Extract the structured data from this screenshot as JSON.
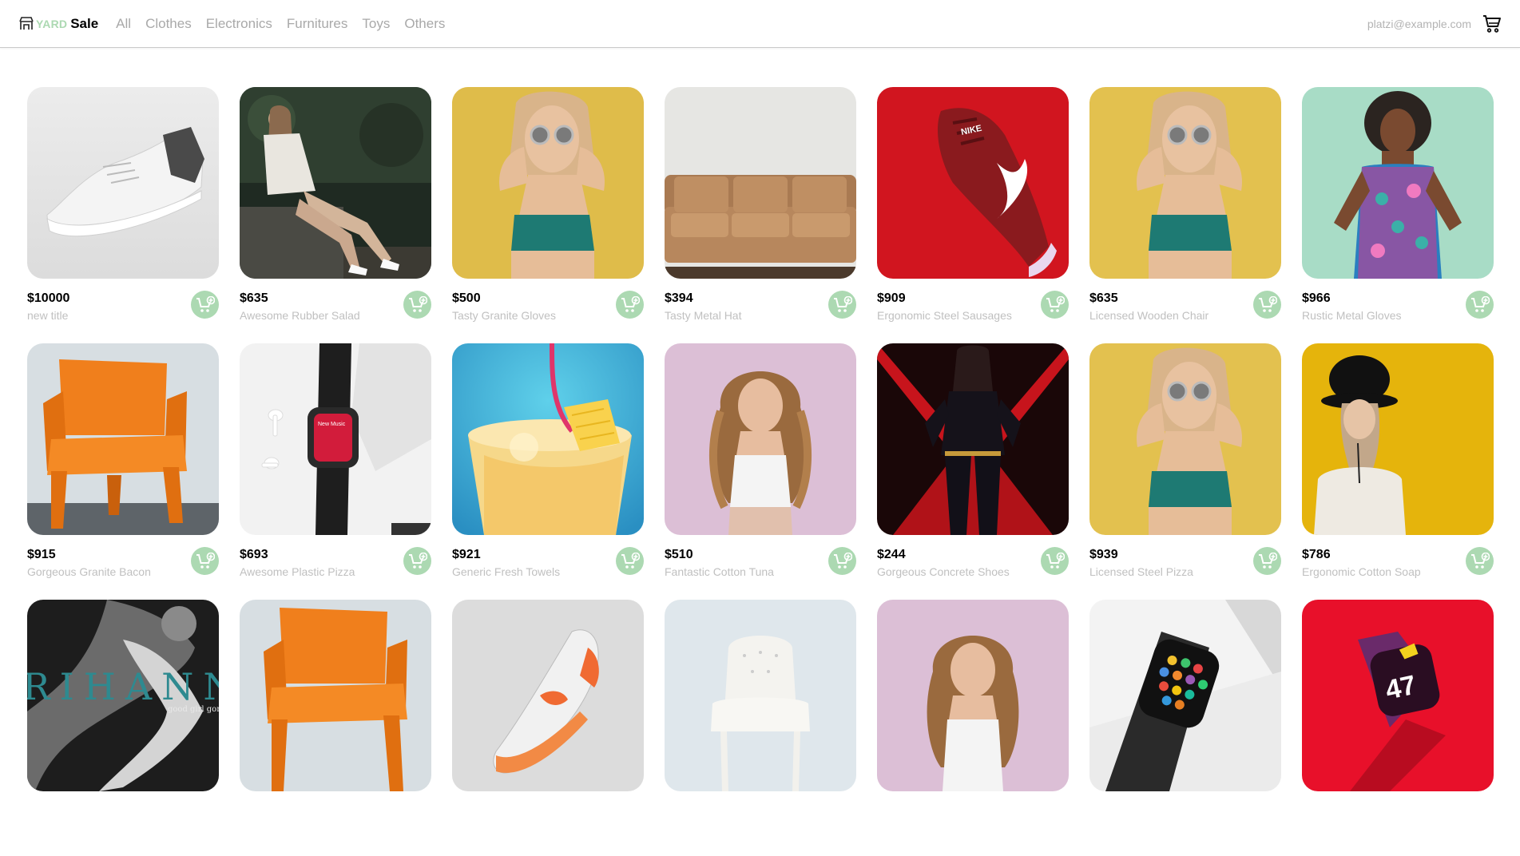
{
  "brand": {
    "yard": "YARD",
    "sale": "Sale",
    "icon": "shop-icon",
    "accent": "#acd9b2"
  },
  "nav": {
    "categories": [
      "All",
      "Clothes",
      "Electronics",
      "Furnitures",
      "Toys",
      "Others"
    ]
  },
  "account": {
    "email": "platzi@example.com",
    "cart_icon": "shopping-cart-icon"
  },
  "products": [
    {
      "price": "$10000",
      "name": "new title",
      "image": "white-sneaker"
    },
    {
      "price": "$635",
      "name": "Awesome Rubber Salad",
      "image": "woman-sitting-outdoors"
    },
    {
      "price": "$500",
      "name": "Tasty Granite Gloves",
      "image": "woman-sunglasses-yellow"
    },
    {
      "price": "$394",
      "name": "Tasty Metal Hat",
      "image": "leather-sofa"
    },
    {
      "price": "$909",
      "name": "Ergonomic Steel Sausages",
      "image": "red-running-shoe"
    },
    {
      "price": "$635",
      "name": "Licensed Wooden Chair",
      "image": "woman-sunglasses-yellow"
    },
    {
      "price": "$966",
      "name": "Rustic Metal Gloves",
      "image": "woman-floral-dress"
    },
    {
      "price": "$915",
      "name": "Gorgeous Granite Bacon",
      "image": "orange-chair"
    },
    {
      "price": "$693",
      "name": "Awesome Plastic Pizza",
      "image": "smartwatch-earbuds"
    },
    {
      "price": "$921",
      "name": "Generic Fresh Towels",
      "image": "pineapple-drink"
    },
    {
      "price": "$510",
      "name": "Fantastic Cotton Tuna",
      "image": "woman-curly-hair-pink"
    },
    {
      "price": "$244",
      "name": "Gorgeous Concrete Shoes",
      "image": "black-widow-poster"
    },
    {
      "price": "$939",
      "name": "Licensed Steel Pizza",
      "image": "woman-sunglasses-yellow"
    },
    {
      "price": "$786",
      "name": "Ergonomic Cotton Soap",
      "image": "woman-hat-yellow"
    },
    {
      "price": "",
      "name": "",
      "image": "rihanna-poster"
    },
    {
      "price": "",
      "name": "",
      "image": "orange-chair"
    },
    {
      "price": "",
      "name": "",
      "image": "white-orange-sneaker"
    },
    {
      "price": "",
      "name": "",
      "image": "white-armchair"
    },
    {
      "price": "",
      "name": "",
      "image": "woman-curly-hair-pink"
    },
    {
      "price": "",
      "name": "",
      "image": "apple-watch"
    },
    {
      "price": "",
      "name": "",
      "image": "red-watch"
    }
  ],
  "image_text": {
    "rihanna": "RIHANNA",
    "rihanna_sub": "good girl gone",
    "watch_screen": "New Music",
    "nike_logo": "NIKE",
    "watch_47": "47"
  },
  "add_to_cart_icon": "add-to-cart-icon"
}
